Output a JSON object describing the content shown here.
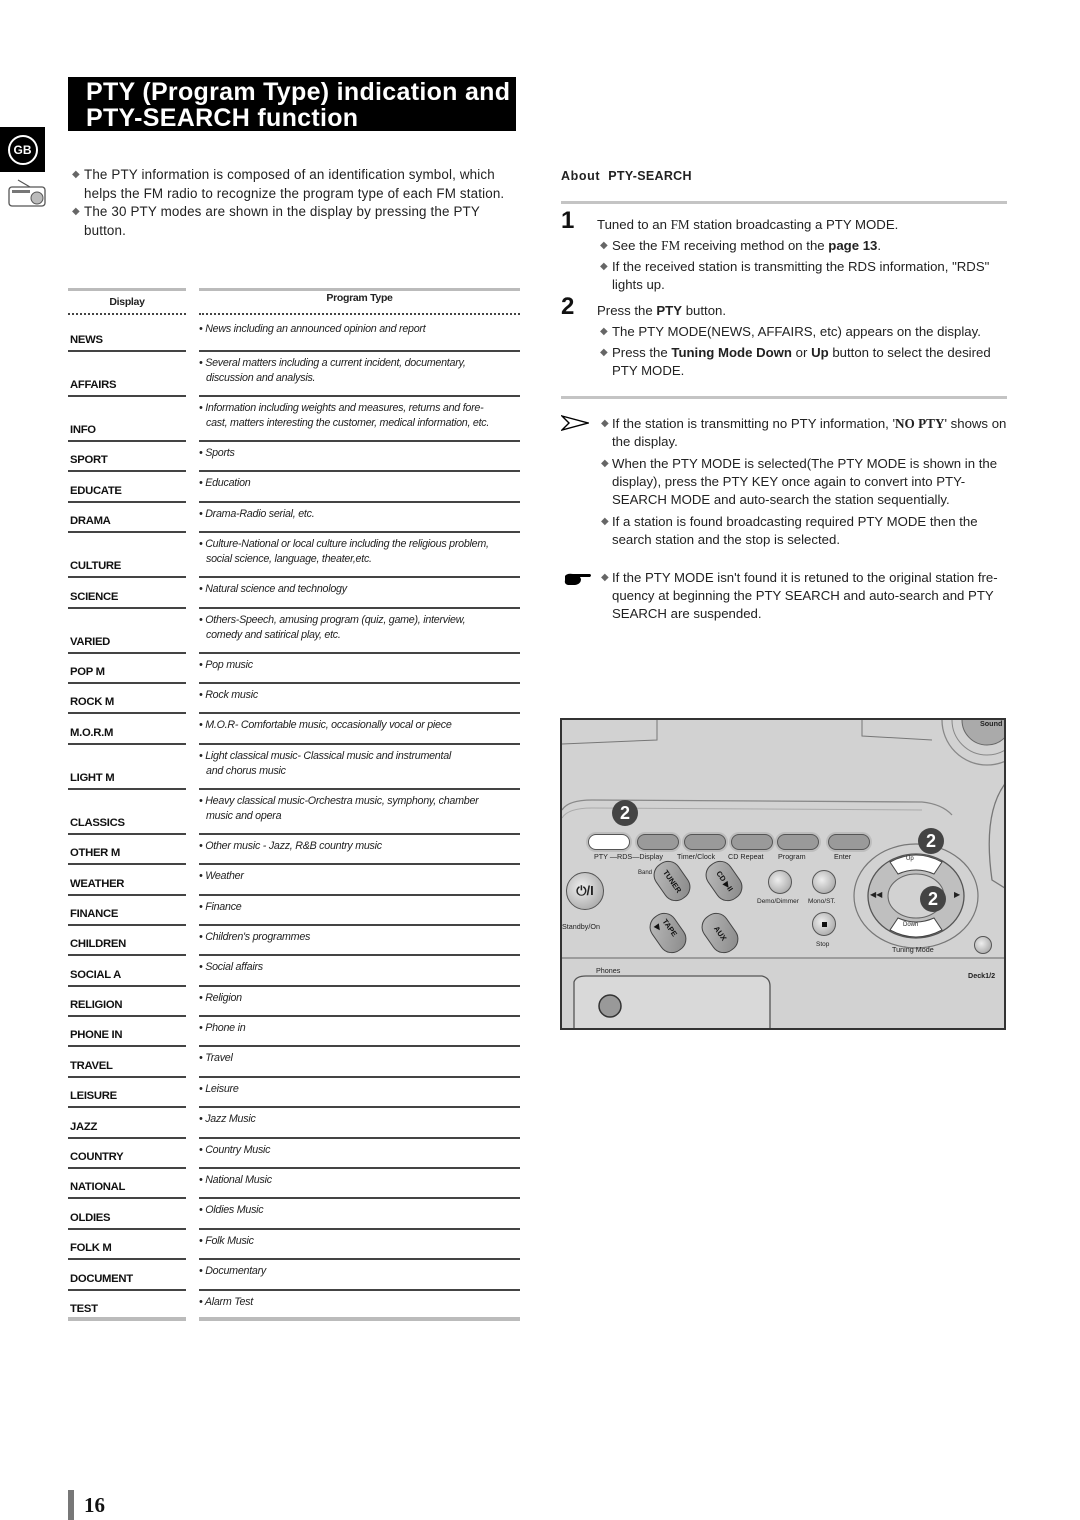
{
  "title": {
    "line1": "PTY (Program Type) indication and",
    "line2": "PTY-SEARCH function"
  },
  "side_tab": {
    "language": "GB",
    "section_icon": "radio-icon"
  },
  "intro": {
    "bullets": [
      "The PTY information is composed of an identification symbol, which helps the FM radio to recognize the program type of each FM station.",
      "The 30 PTY modes are shown in the display by pressing the PTY button."
    ]
  },
  "table": {
    "headers": {
      "display": "Display",
      "program_type": "Program Type"
    },
    "rows": [
      {
        "display": "NEWS",
        "program": [
          "• News including an announced opinion and report"
        ]
      },
      {
        "display": "AFFAIRS",
        "program": [
          "• Several matters including a current incident, documentary,",
          "discussion and analysis."
        ]
      },
      {
        "display": "INFO",
        "program": [
          "•  Information including weights and measures, returns and fore-",
          "cast, matters interesting the customer, medical information, etc."
        ]
      },
      {
        "display": "SPORT",
        "program": [
          "• Sports"
        ]
      },
      {
        "display": "EDUCATE",
        "program": [
          "• Education"
        ]
      },
      {
        "display": "DRAMA",
        "program": [
          "• Drama-Radio serial, etc."
        ]
      },
      {
        "display": "CULTURE",
        "program": [
          "• Culture-National or local culture including the religious problem,",
          "social science, language, theater,etc."
        ]
      },
      {
        "display": "SCIENCE",
        "program": [
          "• Natural science and technology"
        ]
      },
      {
        "display": "VARIED",
        "program": [
          "• Others-Speech, amusing program (quiz, game), interview,",
          "comedy and satirical play, etc."
        ]
      },
      {
        "display": "POP M",
        "program": [
          "• Pop music"
        ]
      },
      {
        "display": "ROCK M",
        "program": [
          "• Rock music"
        ]
      },
      {
        "display": "M.O.R.M",
        "program": [
          "• M.O.R- Comfortable music, occasionally vocal or piece"
        ]
      },
      {
        "display": "LIGHT M",
        "program": [
          "• Light classical music- Classical music and instrumental",
          "and chorus music"
        ]
      },
      {
        "display": "CLASSICS",
        "program": [
          "• Heavy classical  music-Orchestra music, symphony, chamber",
          "music and opera"
        ]
      },
      {
        "display": "OTHER M",
        "program": [
          "• Other music - Jazz, R&B country music"
        ]
      },
      {
        "display": "WEATHER",
        "program": [
          "• Weather"
        ]
      },
      {
        "display": "FINANCE",
        "program": [
          "• Finance"
        ]
      },
      {
        "display": "CHILDREN",
        "program": [
          "• Children's programmes"
        ]
      },
      {
        "display": "SOCIAL A",
        "program": [
          "• Social affairs"
        ]
      },
      {
        "display": "RELIGION",
        "program": [
          "• Religion"
        ]
      },
      {
        "display": "PHONE IN",
        "program": [
          "• Phone in"
        ]
      },
      {
        "display": "TRAVEL",
        "program": [
          "• Travel"
        ]
      },
      {
        "display": "LEISURE",
        "program": [
          "• Leisure"
        ]
      },
      {
        "display": "JAZZ",
        "program": [
          "• Jazz Music"
        ]
      },
      {
        "display": "COUNTRY",
        "program": [
          "• Country Music"
        ]
      },
      {
        "display": "NATIONAL",
        "program": [
          "• National Music"
        ]
      },
      {
        "display": "OLDIES",
        "program": [
          "• Oldies Music"
        ]
      },
      {
        "display": "FOLK M",
        "program": [
          "• Folk Music"
        ]
      },
      {
        "display": "DOCUMENT",
        "program": [
          "• Documentary"
        ]
      },
      {
        "display": "TEST",
        "program": [
          "• Alarm Test"
        ]
      }
    ]
  },
  "about": {
    "heading_prefix": "About",
    "heading_main": "PTY-SEARCH",
    "steps": [
      {
        "number": "1",
        "text_before": "Tuned to an ",
        "text_fm": "FM",
        "text_after": " station broadcasting a PTY MODE.",
        "subs": [
          {
            "before": "See the ",
            "fm": "FM",
            "middle": " receiving method on the ",
            "bold": "page 13",
            "after": "."
          },
          {
            "text": "If the received station is transmitting the RDS information, \"RDS\" lights up."
          }
        ]
      },
      {
        "number": "2",
        "text_before": "Press the ",
        "text_bold": "PTY",
        "text_after": " button.",
        "subs": [
          {
            "text": "The PTY MODE(NEWS, AFFAIRS, etc) appears on the display."
          },
          {
            "before": "Press the ",
            "bold1": "Tuning Mode Down",
            "middle": " or ",
            "bold2": "Up",
            "after": " button to select the desired PTY MODE."
          }
        ]
      }
    ]
  },
  "notes": {
    "arrow_notes": [
      {
        "before": "If the station is transmitting no PTY information, '",
        "bold": "NO PTY",
        "after": "' shows on the display."
      },
      {
        "text": "When the PTY MODE is selected(The PTY MODE is shown in  the display), press the PTY KEY once again to convert into PTY-SEARCH MODE and auto-search the station sequentially."
      },
      {
        "text": "If a station is found broadcasting required PTY MODE then the search station and the stop is selected."
      }
    ],
    "pointer_note": "If the PTY MODE isn't found it is retuned to the original station fre-quency at beginning the PTY SEARCH and auto-search and PTY SEARCH are suspended."
  },
  "device": {
    "callout_number": "2",
    "top_right_label": "Sound",
    "button_labels": {
      "pty_rds_display": "PTY —RDS—Display",
      "timer_clock": "Timer/Clock",
      "cd_repeat": "CD Repeat",
      "program": "Program",
      "enter": "Enter",
      "band": "Band",
      "tuner": "TUNER",
      "cd": "CD ▶II",
      "tape": "TAPE ▶",
      "aux": "AUX",
      "demo_dimmer": "Demo/Dimmer",
      "mono_st": "Mono/ST.",
      "stop": "Stop",
      "standby_on": "Standby/On",
      "power_symbol": "⏻/I",
      "up": "Up",
      "down": "Down",
      "tuning_mode": "Tuning Mode",
      "phones": "Phones",
      "deck": "Deck1/2"
    }
  },
  "page_number": "16"
}
